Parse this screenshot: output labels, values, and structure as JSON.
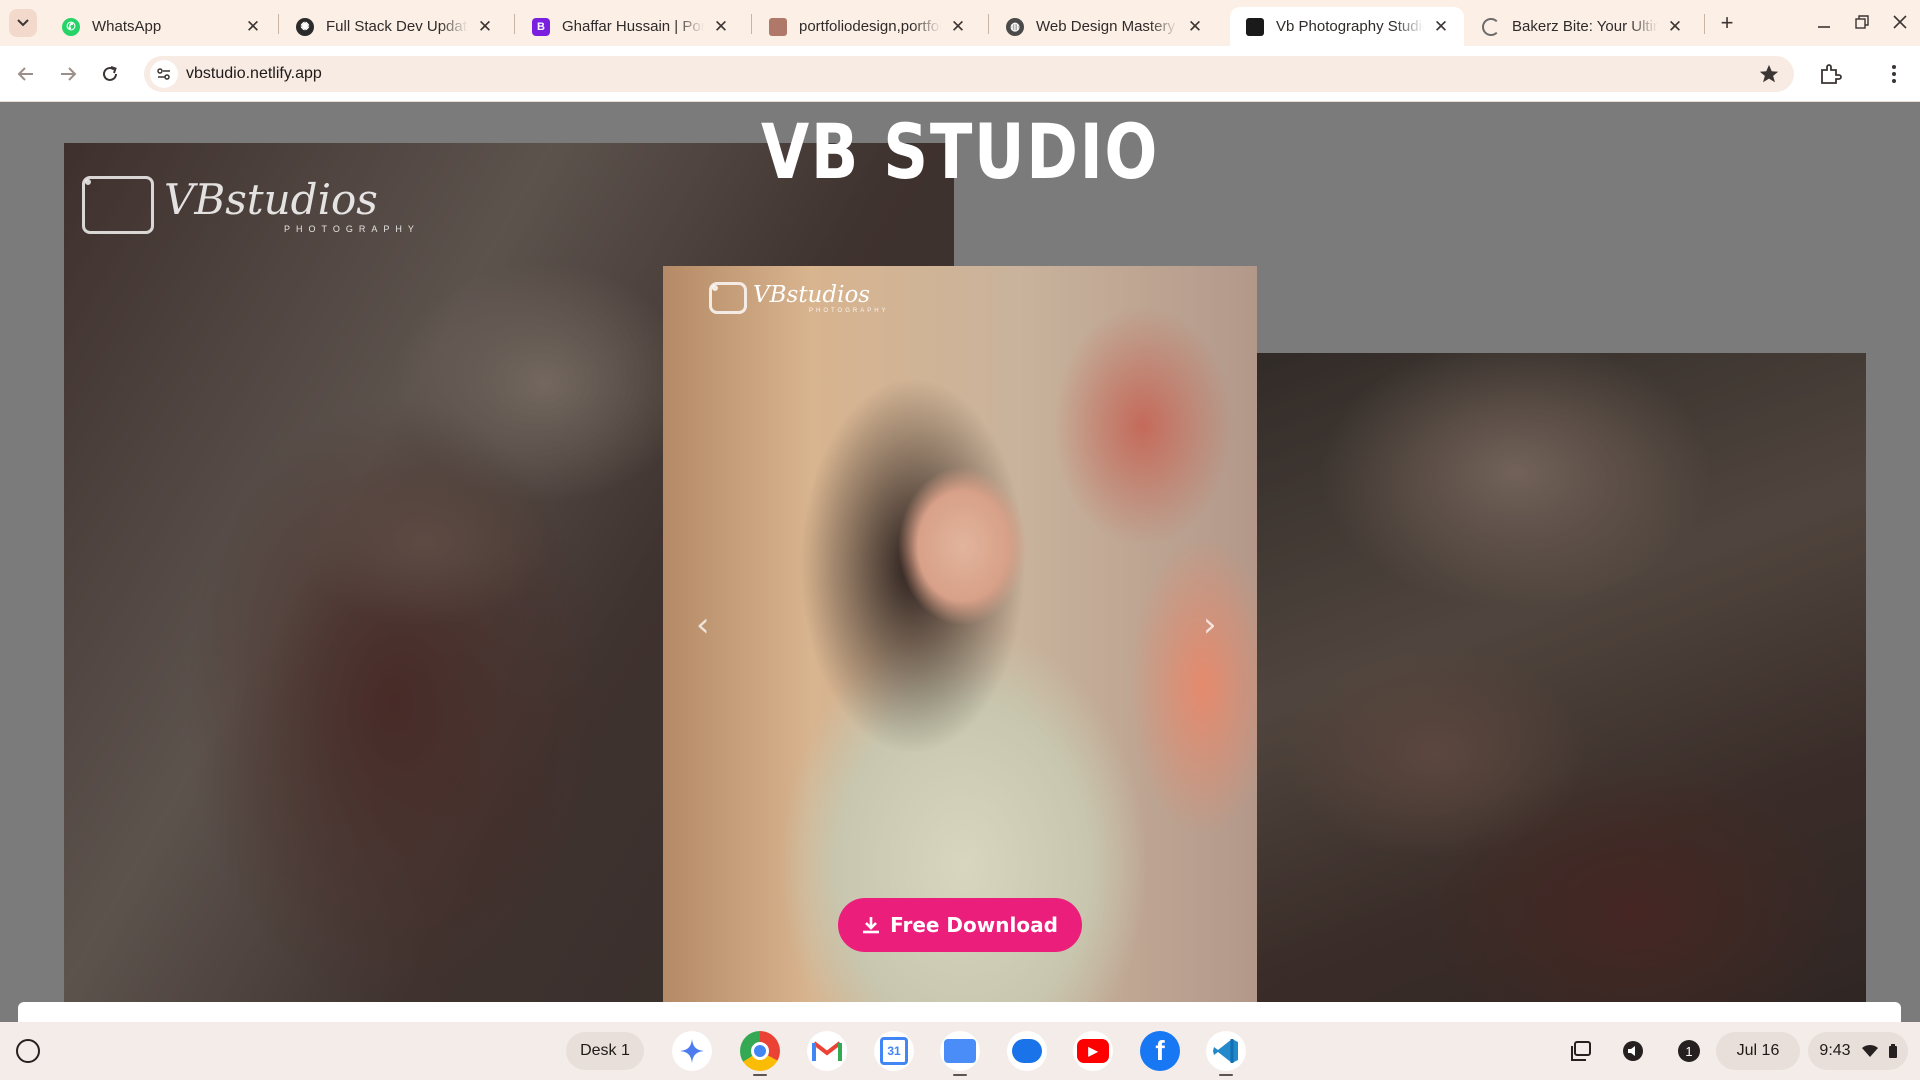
{
  "browser": {
    "tabs": [
      {
        "title": "WhatsApp",
        "favicon": "whatsapp-icon",
        "color": "#25d366",
        "active": false
      },
      {
        "title": "Full Stack Dev Update",
        "favicon": "chatgpt-icon",
        "color": "#2b2b2b",
        "active": false
      },
      {
        "title": "Ghaffar Hussain | Portfolio",
        "favicon": "bootstrap-icon",
        "color": "#7a1fe0",
        "active": false
      },
      {
        "title": "portfoliodesign,portfolio",
        "favicon": "image-icon",
        "color": "#b07868",
        "active": false
      },
      {
        "title": "Web Design Mastery | Ca",
        "favicon": "globe-icon",
        "color": "#4a4a4a",
        "active": false
      },
      {
        "title": "Vb Photography Studio |",
        "favicon": "vb-studio-icon",
        "color": "#1a1a1a",
        "active": true
      },
      {
        "title": "Bakerz Bite: Your Ultimate",
        "favicon": "loading-icon",
        "color": "#6b6b6b",
        "active": false
      }
    ],
    "url": "vbstudio.netlify.app"
  },
  "page": {
    "title": "VB STUDIO",
    "logo_text": "VBstudios",
    "logo_sub": "PHOTOGRAPHY",
    "download_label": "Free Download",
    "accent": "#ec1e7c"
  },
  "shelf": {
    "desk_label": "Desk 1",
    "apps": [
      "gemini-icon",
      "chrome-icon",
      "gmail-icon",
      "calendar-icon",
      "files-icon",
      "messages-icon",
      "youtube-icon",
      "facebook-icon",
      "vscode-icon"
    ],
    "notification_count": "1",
    "date": "Jul 16",
    "time": "9:43"
  }
}
